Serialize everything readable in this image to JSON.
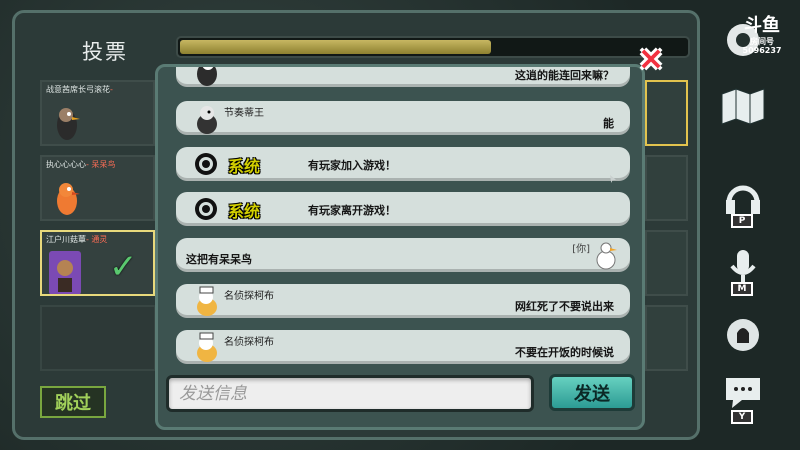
{
  "header": {
    "vote_title": "投票",
    "timer_progress": 0.61
  },
  "players": [
    {
      "name": "战意茜席长弓滚花",
      "role": "-"
    },
    {
      "name": "执心心心心",
      "role": "- 呆呆鸟"
    },
    {
      "name": "江户川菇蕈",
      "role": "- 通灵"
    }
  ],
  "chat": {
    "messages": [
      {
        "type": "text",
        "sender": "",
        "text": "这逍的能连回来嘛？"
      },
      {
        "type": "text",
        "sender": "节奏蒂王",
        "text": "能"
      },
      {
        "type": "system",
        "label": "系统",
        "text": "有玩家加入游戏！"
      },
      {
        "type": "system",
        "label": "系统",
        "text": "有玩家离开游戏！"
      },
      {
        "type": "self",
        "tag": "[你]",
        "text": "这把有呆呆鸟"
      },
      {
        "type": "text",
        "sender": "名侦探柯布",
        "text": "网红死了不要说出来"
      },
      {
        "type": "text",
        "sender": "名侦探柯布",
        "text": "不要在开饭的时候说"
      }
    ],
    "input_placeholder": "发送信息",
    "send_label": "发送"
  },
  "skip_label": "跳过",
  "side_controls": [
    {
      "name": "gear-icon"
    },
    {
      "name": "map-icon"
    },
    {
      "name": "headphones-icon",
      "key": "P"
    },
    {
      "name": "microphone-icon",
      "key": "M"
    },
    {
      "name": "bell-icon"
    },
    {
      "name": "chat-icon",
      "key": "Y"
    }
  ],
  "watermark": {
    "logo": "斗鱼",
    "line1": "房间号",
    "line2": "5096237"
  },
  "colors": {
    "accent_yellow": "#d3d000",
    "send_teal": "#3fb3aa",
    "close_red": "#f23140",
    "skip_green": "#a1d05a"
  }
}
